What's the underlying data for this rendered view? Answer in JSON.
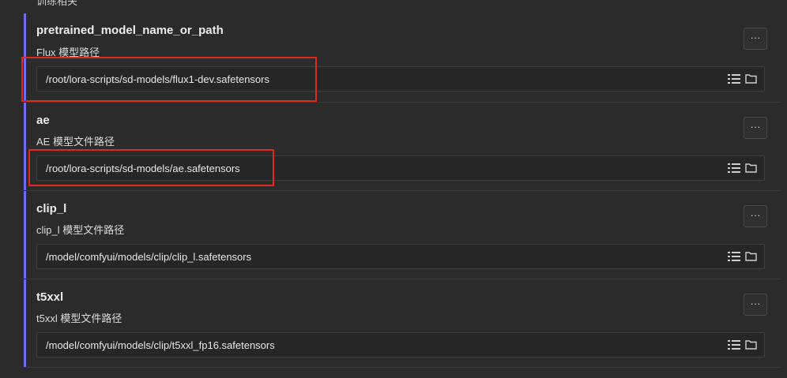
{
  "header": {
    "cut_label": "训练相关"
  },
  "settings": [
    {
      "title": "pretrained_model_name_or_path",
      "description": "Flux 模型路径",
      "value": "/root/lora-scripts/sd-models/flux1-dev.safetensors",
      "more_label": "···"
    },
    {
      "title": "ae",
      "description": "AE 模型文件路径",
      "value": "/root/lora-scripts/sd-models/ae.safetensors",
      "more_label": "···"
    },
    {
      "title": "clip_l",
      "description": "clip_l 模型文件路径",
      "value": "/model/comfyui/models/clip/clip_l.safetensors",
      "more_label": "···"
    },
    {
      "title": "t5xxl",
      "description": "t5xxl 模型文件路径",
      "value": "/model/comfyui/models/clip/t5xxl_fp16.safetensors",
      "more_label": "···"
    }
  ],
  "icons": {
    "list": "list-icon",
    "folder": "folder-icon"
  },
  "colors": {
    "accent": "#6d6df2",
    "highlight": "#e0281e",
    "background": "#2b2b2b"
  }
}
